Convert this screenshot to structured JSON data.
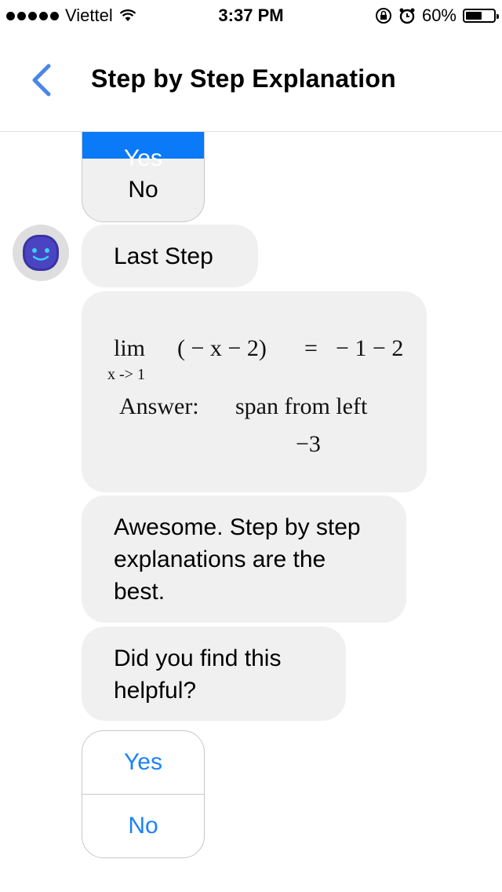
{
  "status_bar": {
    "carrier": "Viettel",
    "time": "3:37 PM",
    "battery": "60%",
    "battery_level": 0.6
  },
  "nav": {
    "title": "Step by Step Explanation"
  },
  "top_choice": {
    "yes_label": "Yes",
    "no_label": "No"
  },
  "messages": {
    "last_step": "Last Step",
    "math": {
      "lim": "lim",
      "sub": "x -> 1",
      "expr": "( − x − 2)",
      "eq": "=",
      "rhs": "− 1 − 2",
      "answer_label": "Answer:",
      "answer_text": "span from left",
      "answer_value": "−3"
    },
    "awesome": "Awesome. Step by step explanations are the best.",
    "helpful": "Did you find this helpful?"
  },
  "bottom_choice": {
    "yes_label": "Yes",
    "no_label": "No"
  },
  "colors": {
    "accent": "#1a82fb",
    "selected_fill": "#0a7af8",
    "bubble": "#f0f0f0",
    "back": "#4a86e8"
  }
}
